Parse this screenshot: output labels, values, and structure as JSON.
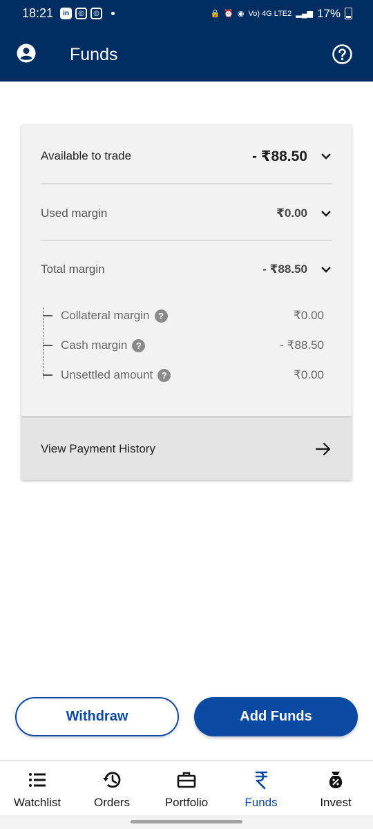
{
  "status_bar": {
    "time": "18:21",
    "network": "Vo) 4G LTE2",
    "battery_pct": "17%"
  },
  "header": {
    "title": "Funds"
  },
  "funds": {
    "available": {
      "label": "Available to trade",
      "value": "- ₹88.50"
    },
    "used_margin": {
      "label": "Used margin",
      "value": "₹0.00"
    },
    "total_margin": {
      "label": "Total margin",
      "value": "- ₹88.50"
    },
    "breakdown": [
      {
        "label": "Collateral margin",
        "value": "₹0.00"
      },
      {
        "label": "Cash margin",
        "value": "- ₹88.50"
      },
      {
        "label": "Unsettled amount",
        "value": "₹0.00"
      }
    ],
    "history_label": "View Payment History"
  },
  "actions": {
    "withdraw": "Withdraw",
    "add_funds": "Add Funds"
  },
  "nav": {
    "items": [
      {
        "label": "Watchlist",
        "icon": "list-icon"
      },
      {
        "label": "Orders",
        "icon": "history-icon"
      },
      {
        "label": "Portfolio",
        "icon": "briefcase-icon"
      },
      {
        "label": "Funds",
        "icon": "rupee-icon"
      },
      {
        "label": "Invest",
        "icon": "money-bag-icon"
      }
    ],
    "active": "Funds"
  },
  "colors": {
    "header_bg": "#002e63",
    "accent": "#0b4aa3"
  }
}
